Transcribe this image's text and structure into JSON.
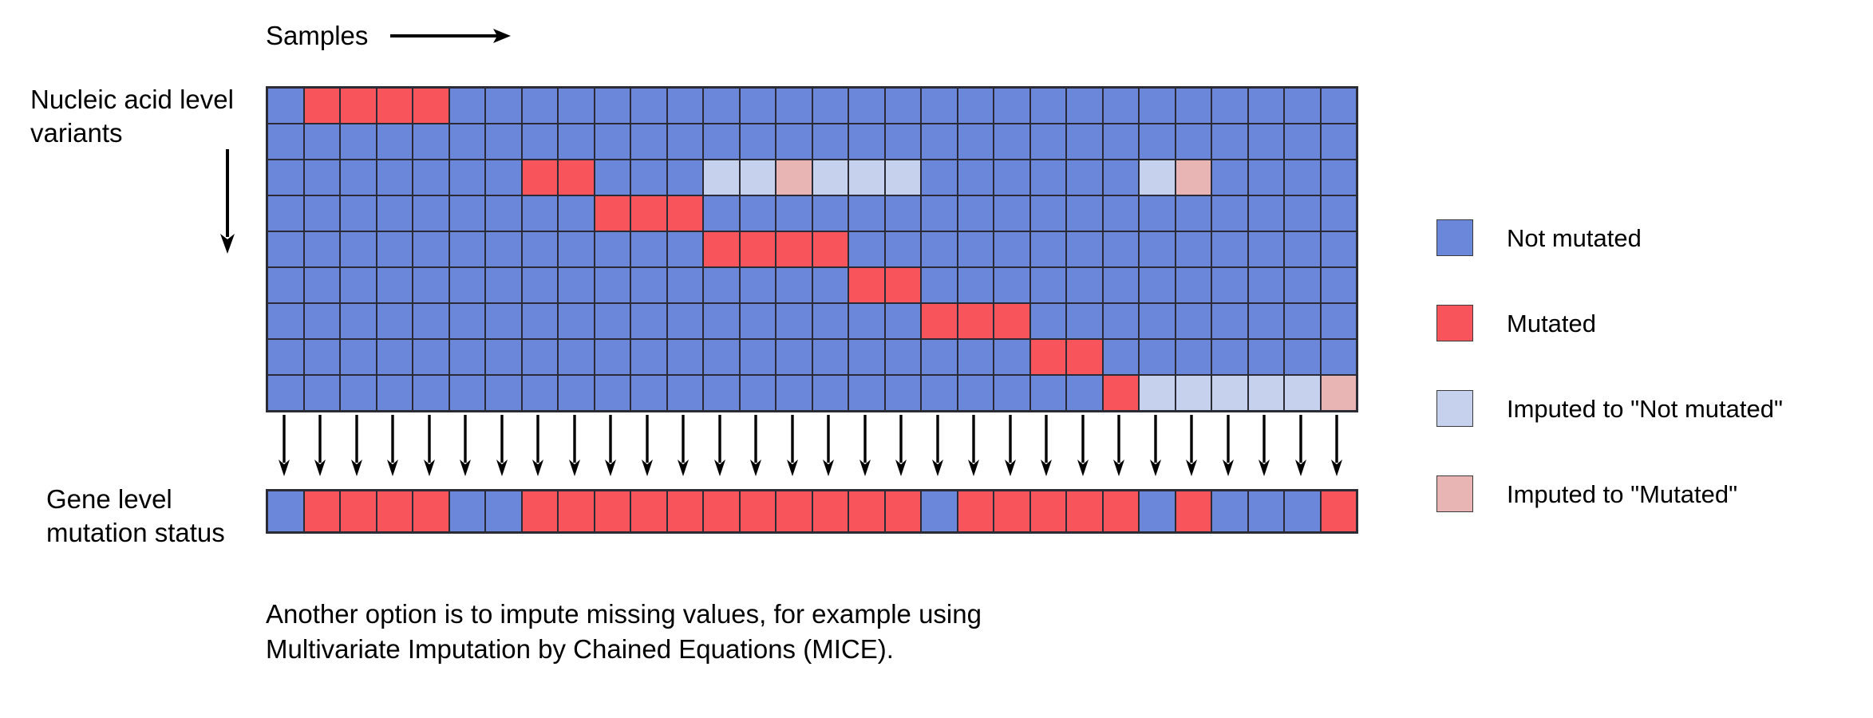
{
  "header": {
    "samples_label": "Samples",
    "samples_arrow_icon": "right-arrow-icon"
  },
  "left_labels": {
    "nucleic_line1": "Nucleic acid level",
    "nucleic_line2": "variants",
    "nucleic_full": "Nucleic acid level variants",
    "down_arrow_icon": "down-arrow-icon",
    "gene_line1": "Gene level",
    "gene_line2": "mutation status",
    "gene_full": "Gene level mutation status"
  },
  "colors": {
    "not_mutated": "#6b87da",
    "mutated": "#f7555b",
    "imputed_not_mutated": "#c6d2ed",
    "imputed_mutated": "#e8b4b4",
    "grid_line": "#2b2b35",
    "text": "#000000",
    "background": "#ffffff"
  },
  "legend": {
    "items": [
      {
        "label": "Not mutated",
        "color_key": "not_mutated",
        "swatch_icon": "blue-square-icon"
      },
      {
        "label": "Mutated",
        "color_key": "mutated",
        "swatch_icon": "red-square-icon"
      },
      {
        "label": "Imputed to \"Not mutated\"",
        "color_key": "imputed_not_mutated",
        "swatch_icon": "light-blue-square-icon"
      },
      {
        "label": "Imputed to \"Mutated\"",
        "color_key": "imputed_mutated",
        "swatch_icon": "light-red-square-icon"
      }
    ]
  },
  "caption": {
    "line1": "Another option is to impute missing values, for example using",
    "line2": "Multivariate Imputation by Chained Equations (MICE)."
  },
  "chart_data": {
    "type": "heatmap",
    "title": "",
    "xlabel": "Samples",
    "ylabel": "Nucleic acid level variants",
    "n_columns": 30,
    "n_rows": 9,
    "value_legend": {
      "0": "Not mutated",
      "1": "Mutated",
      "2": "Imputed to \"Not mutated\"",
      "3": "Imputed to \"Mutated\""
    },
    "matrix": [
      [
        0,
        1,
        1,
        1,
        1,
        0,
        0,
        0,
        0,
        0,
        0,
        0,
        0,
        0,
        0,
        0,
        0,
        0,
        0,
        0,
        0,
        0,
        0,
        0,
        0,
        0,
        0,
        0,
        0,
        0
      ],
      [
        0,
        0,
        0,
        0,
        0,
        0,
        0,
        0,
        0,
        0,
        0,
        0,
        0,
        0,
        0,
        0,
        0,
        0,
        0,
        0,
        0,
        0,
        0,
        0,
        0,
        0,
        0,
        0,
        0,
        0
      ],
      [
        0,
        0,
        0,
        0,
        0,
        0,
        0,
        1,
        1,
        0,
        0,
        0,
        2,
        2,
        3,
        2,
        2,
        2,
        0,
        0,
        0,
        0,
        0,
        0,
        2,
        3,
        0,
        0,
        0,
        0
      ],
      [
        0,
        0,
        0,
        0,
        0,
        0,
        0,
        0,
        0,
        1,
        1,
        1,
        0,
        0,
        0,
        0,
        0,
        0,
        0,
        0,
        0,
        0,
        0,
        0,
        0,
        0,
        0,
        0,
        0,
        0
      ],
      [
        0,
        0,
        0,
        0,
        0,
        0,
        0,
        0,
        0,
        0,
        0,
        0,
        1,
        1,
        1,
        1,
        0,
        0,
        0,
        0,
        0,
        0,
        0,
        0,
        0,
        0,
        0,
        0,
        0,
        0
      ],
      [
        0,
        0,
        0,
        0,
        0,
        0,
        0,
        0,
        0,
        0,
        0,
        0,
        0,
        0,
        0,
        0,
        1,
        1,
        0,
        0,
        0,
        0,
        0,
        0,
        0,
        0,
        0,
        0,
        0,
        0
      ],
      [
        0,
        0,
        0,
        0,
        0,
        0,
        0,
        0,
        0,
        0,
        0,
        0,
        0,
        0,
        0,
        0,
        0,
        0,
        1,
        1,
        1,
        0,
        0,
        0,
        0,
        0,
        0,
        0,
        0,
        0
      ],
      [
        0,
        0,
        0,
        0,
        0,
        0,
        0,
        0,
        0,
        0,
        0,
        0,
        0,
        0,
        0,
        0,
        0,
        0,
        0,
        0,
        0,
        1,
        1,
        0,
        0,
        0,
        0,
        0,
        0,
        0
      ],
      [
        0,
        0,
        0,
        0,
        0,
        0,
        0,
        0,
        0,
        0,
        0,
        0,
        0,
        0,
        0,
        0,
        0,
        0,
        0,
        0,
        0,
        0,
        0,
        1,
        2,
        2,
        2,
        2,
        2,
        3
      ]
    ],
    "gene_level_row": [
      0,
      1,
      1,
      1,
      1,
      0,
      0,
      1,
      1,
      1,
      1,
      1,
      1,
      1,
      1,
      1,
      1,
      1,
      0,
      1,
      1,
      1,
      1,
      1,
      0,
      1,
      0,
      0,
      0,
      1
    ],
    "arrow_count": 30
  }
}
